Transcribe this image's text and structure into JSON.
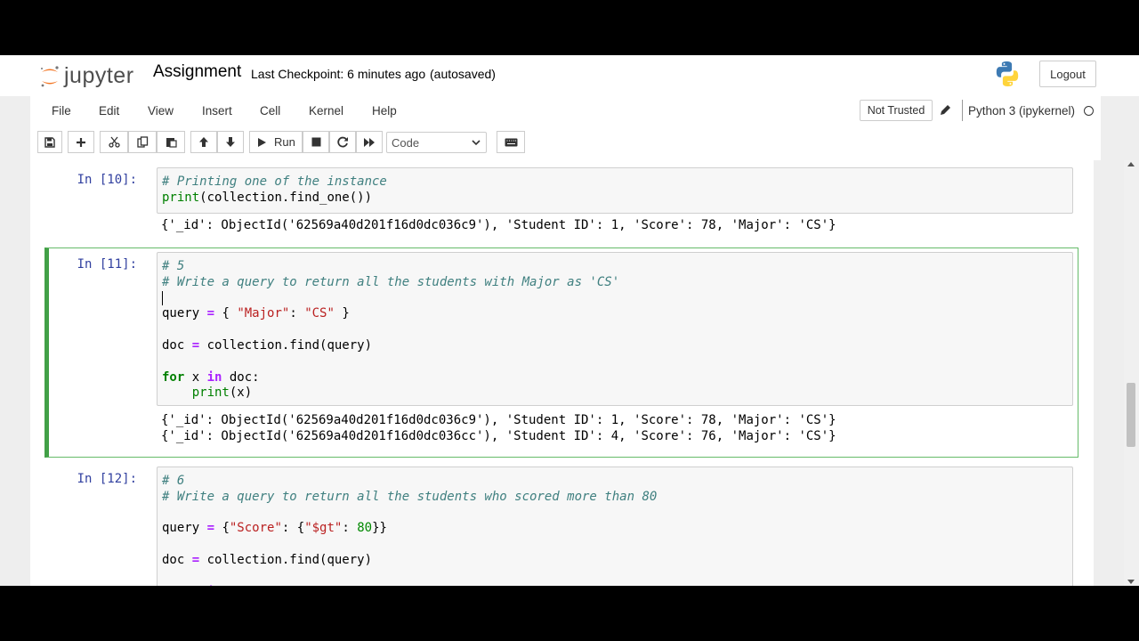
{
  "header": {
    "logo_text": "jupyter",
    "notebook_title": "Assignment",
    "checkpoint": "Last Checkpoint: 6 minutes ago",
    "autosaved": "(autosaved)",
    "logout_label": "Logout"
  },
  "menubar": {
    "items": [
      "File",
      "Edit",
      "View",
      "Insert",
      "Cell",
      "Kernel",
      "Help"
    ],
    "not_trusted": "Not Trusted",
    "kernel": "Python 3 (ipykernel)"
  },
  "toolbar": {
    "run_label": "Run",
    "cell_type": "Code"
  },
  "cells": [
    {
      "prompt": "In [10]:",
      "code_lines": [
        "# Printing one of the instance",
        "print(collection.find_one())"
      ],
      "output": [
        "{'_id': ObjectId('62569a40d201f16d0dc036c9'), 'Student ID': 1, 'Score': 78, 'Major': 'CS'}"
      ]
    },
    {
      "prompt": "In [11]:",
      "code_lines": [
        "# 5",
        "# Write a query to return all the students with Major as 'CS'",
        "",
        "query = { \"Major\": \"CS\" }",
        "",
        "doc = collection.find(query)",
        "",
        "for x in doc:",
        "    print(x)"
      ],
      "output": [
        "{'_id': ObjectId('62569a40d201f16d0dc036c9'), 'Student ID': 1, 'Score': 78, 'Major': 'CS'}",
        "{'_id': ObjectId('62569a40d201f16d0dc036cc'), 'Student ID': 4, 'Score': 76, 'Major': 'CS'}"
      ]
    },
    {
      "prompt": "In [12]:",
      "code_lines": [
        "# 6",
        "# Write a query to return all the students who scored more than 80",
        "",
        "query = {\"Score\": {\"$gt\": 80}}",
        "",
        "doc = collection.find(query)",
        "",
        "for x in doc:"
      ]
    }
  ],
  "colors": {
    "selected_cell_border": "#42a047",
    "prompt": "#303f9f",
    "comment": "#408080",
    "keyword": "#008000",
    "string": "#ba2121"
  }
}
